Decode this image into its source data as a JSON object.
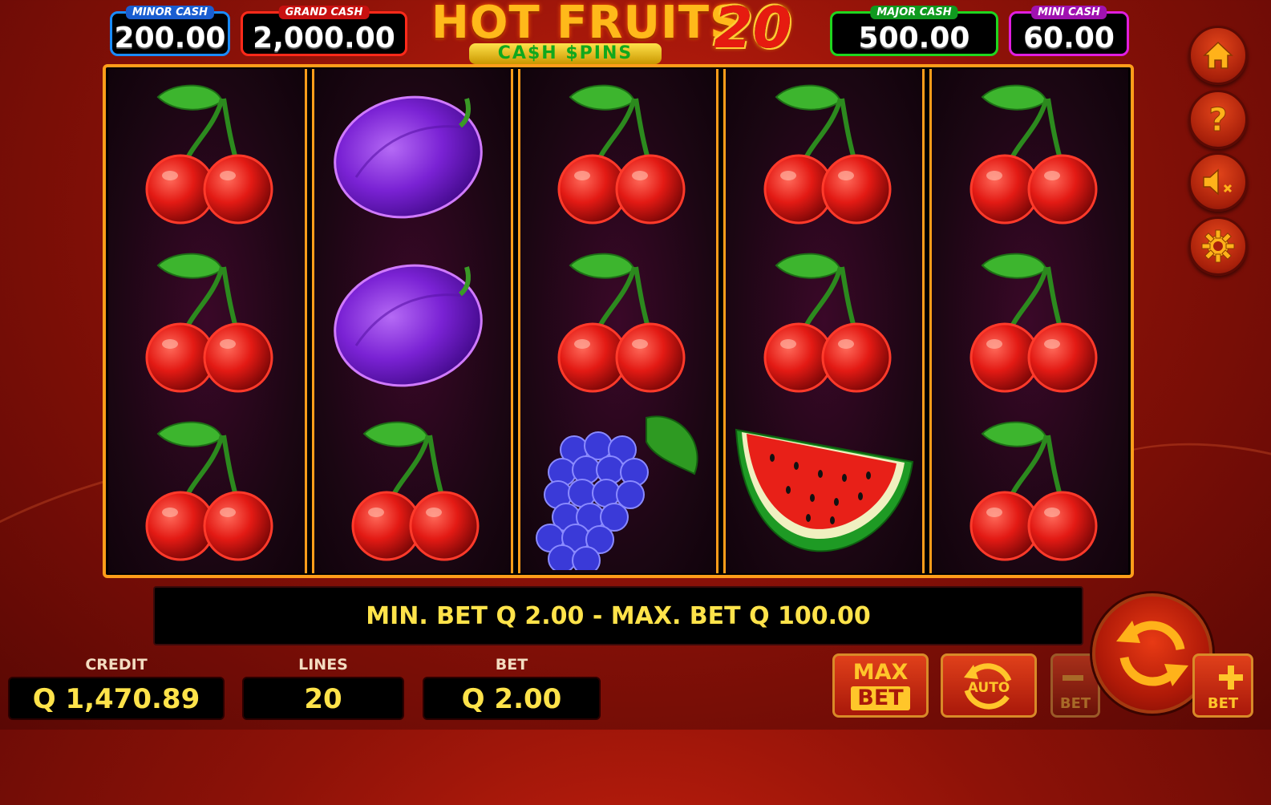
{
  "jackpots": {
    "minor": {
      "label": "MINOR CASH",
      "value": "200.00"
    },
    "grand": {
      "label": "GRAND CASH",
      "value": "2,000.00"
    },
    "major": {
      "label": "MAJOR CASH",
      "value": "500.00"
    },
    "mini": {
      "label": "MINI CASH",
      "value": "60.00"
    }
  },
  "logo": {
    "line1": "HOT FRUITS",
    "number": "20",
    "subtitle": "CA$H $PINS"
  },
  "reels": [
    [
      "cherry",
      "cherry",
      "cherry"
    ],
    [
      "plum",
      "plum",
      "cherry"
    ],
    [
      "cherry",
      "cherry",
      "grapes"
    ],
    [
      "cherry",
      "cherry",
      "watermelon"
    ],
    [
      "cherry",
      "cherry",
      "cherry"
    ]
  ],
  "info_bar": {
    "message": "MIN. BET Q 2.00 - MAX. BET Q 100.00"
  },
  "stats": {
    "credit": {
      "label": "CREDIT",
      "value": "Q 1,470.89"
    },
    "lines": {
      "label": "LINES",
      "value": "20"
    },
    "bet": {
      "label": "BET",
      "value": "Q 2.00"
    }
  },
  "buttons": {
    "max_bet_line1": "MAX",
    "max_bet_line2": "BET",
    "auto_label": "AUTO",
    "bet_minus_label": "BET",
    "bet_plus_label": "BET"
  },
  "side_menu": [
    "home-icon",
    "help-icon",
    "sound-muted-icon",
    "settings-icon"
  ],
  "colors": {
    "accent": "#ffe34a",
    "reel_border": "#ff9d1a",
    "background": "#8e1208"
  }
}
